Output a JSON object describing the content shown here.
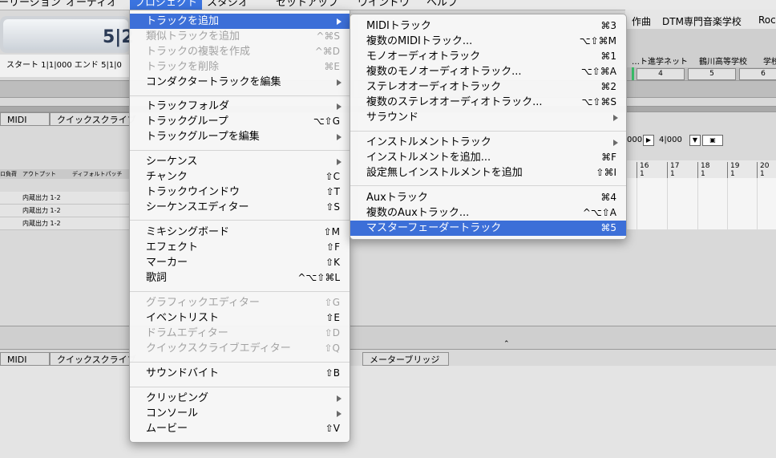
{
  "menubar": {
    "items": [
      {
        "label": "ーリージョン"
      },
      {
        "label": "オーディオ"
      },
      {
        "label": "プロジェクト"
      },
      {
        "label": "スタジオ"
      },
      {
        "label": "セットアップ"
      },
      {
        "label": "ウインドウ"
      },
      {
        "label": "ヘルプ"
      }
    ]
  },
  "bookmarks": {
    "items": [
      "作曲",
      "DTM専門音楽学校",
      "Roc"
    ]
  },
  "bookmarks2": {
    "items": [
      "…ト進学ネット",
      "鶴川高等学校",
      "学校"
    ]
  },
  "transport": {
    "position": "5|2",
    "range": "スタート 1|1|000  エンド 5|1|0"
  },
  "scene_row": {
    "cells": [
      "4",
      "5",
      "6"
    ]
  },
  "tabs_top": {
    "midi": "MIDI",
    "quick": "クイックスクライブ"
  },
  "tabs_bottom": {
    "midi": "MIDI",
    "quick": "クイックスクライブ",
    "meter": "メーターブリッジ"
  },
  "track_list": {
    "head_mute": "ロ負荷",
    "head_output": "アウトプット",
    "head_patch": "ディフォルトパッチ",
    "rows": [
      "内蔵出力 1-2",
      "内蔵出力 1-2",
      "内蔵出力 1-2"
    ]
  },
  "locator": {
    "start": "000",
    "end": "4|000"
  },
  "ruler": {
    "bars": [
      {
        "n": "16",
        "b": "1"
      },
      {
        "n": "17",
        "b": "1"
      },
      {
        "n": "18",
        "b": "1"
      },
      {
        "n": "19",
        "b": "1"
      },
      {
        "n": "20",
        "b": "1"
      }
    ]
  },
  "project_menu": {
    "items": [
      {
        "label": "トラックを追加",
        "shortcut": "",
        "state": "highlighted",
        "submenu": true
      },
      {
        "label": "類似トラックを追加",
        "shortcut": "^⌘S",
        "state": "disabled"
      },
      {
        "label": "トラックの複製を作成",
        "shortcut": "^⌘D",
        "state": "disabled"
      },
      {
        "label": "トラックを削除",
        "shortcut": "⌘E",
        "state": "disabled"
      },
      {
        "label": "コンダクタートラックを編集",
        "shortcut": "",
        "state": "enabled",
        "submenu": true
      },
      {
        "label": "トラックフォルダ",
        "shortcut": "",
        "state": "enabled",
        "submenu": true
      },
      {
        "label": "トラックグループ",
        "shortcut": "⌥⇧G",
        "state": "enabled"
      },
      {
        "label": "トラックグループを編集",
        "shortcut": "",
        "state": "enabled",
        "submenu": true
      },
      {
        "label": "シーケンス",
        "shortcut": "",
        "state": "enabled",
        "submenu": true
      },
      {
        "label": "チャンク",
        "shortcut": "⇧C",
        "state": "enabled"
      },
      {
        "label": "トラックウインドウ",
        "shortcut": "⇧T",
        "state": "enabled"
      },
      {
        "label": "シーケンスエディター",
        "shortcut": "⇧S",
        "state": "enabled"
      },
      {
        "label": "ミキシングボード",
        "shortcut": "⇧M",
        "state": "enabled"
      },
      {
        "label": "エフェクト",
        "shortcut": "⇧F",
        "state": "enabled"
      },
      {
        "label": "マーカー",
        "shortcut": "⇧K",
        "state": "enabled"
      },
      {
        "label": "歌詞",
        "shortcut": "^⌥⇧⌘L",
        "state": "enabled"
      },
      {
        "label": "グラフィックエディター",
        "shortcut": "⇧G",
        "state": "disabled"
      },
      {
        "label": "イベントリスト",
        "shortcut": "⇧E",
        "state": "enabled"
      },
      {
        "label": "ドラムエディター",
        "shortcut": "⇧D",
        "state": "disabled"
      },
      {
        "label": "クイックスクライブエディター",
        "shortcut": "⇧Q",
        "state": "disabled"
      },
      {
        "label": "サウンドバイト",
        "shortcut": "⇧B",
        "state": "enabled"
      },
      {
        "label": "クリッピング",
        "shortcut": "",
        "state": "enabled",
        "submenu": true
      },
      {
        "label": "コンソール",
        "shortcut": "",
        "state": "enabled",
        "submenu": true
      },
      {
        "label": "ムービー",
        "shortcut": "⇧V",
        "state": "enabled"
      }
    ]
  },
  "add_track_submenu": {
    "items": [
      {
        "label": "MIDIトラック",
        "shortcut": "⌘3",
        "state": "enabled"
      },
      {
        "label": "複数のMIDIトラック...",
        "shortcut": "⌥⇧⌘M",
        "state": "enabled"
      },
      {
        "label": "モノオーディオトラック",
        "shortcut": "⌘1",
        "state": "enabled"
      },
      {
        "label": "複数のモノオーディオトラック...",
        "shortcut": "⌥⇧⌘A",
        "state": "enabled"
      },
      {
        "label": "ステレオオーディオトラック",
        "shortcut": "⌘2",
        "state": "enabled"
      },
      {
        "label": "複数のステレオオーディオトラック...",
        "shortcut": "⌥⇧⌘S",
        "state": "enabled"
      },
      {
        "label": "サラウンド",
        "shortcut": "",
        "state": "enabled",
        "submenu": true
      },
      {
        "label": "インストルメントトラック",
        "shortcut": "",
        "state": "enabled",
        "submenu": true
      },
      {
        "label": "インストルメントを追加...",
        "shortcut": "⌘F",
        "state": "enabled"
      },
      {
        "label": "設定無しインストルメントを追加",
        "shortcut": "⇧⌘I",
        "state": "enabled"
      },
      {
        "label": "Auxトラック",
        "shortcut": "⌘4",
        "state": "enabled"
      },
      {
        "label": "複数のAuxトラック...",
        "shortcut": "^⌥⇧A",
        "state": "enabled"
      },
      {
        "label": "マスターフェーダートラック",
        "shortcut": "⌘5",
        "state": "highlighted"
      }
    ]
  },
  "colors": {
    "highlight": "#3c6fd8",
    "menubar_active": "#3b74e0"
  }
}
